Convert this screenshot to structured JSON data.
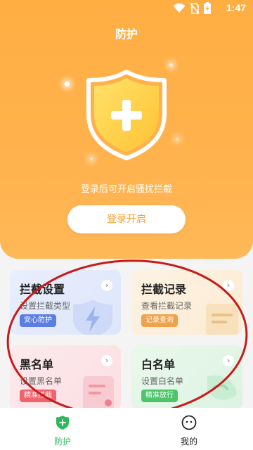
{
  "status": {
    "time": "1:47",
    "icons": [
      "wifi-icon",
      "no-sim-icon",
      "battery-charging-icon"
    ]
  },
  "header": {
    "title": "防护"
  },
  "hero": {
    "hint": "登录后可开启骚扰拦截",
    "login_label": "登录开启",
    "shield_icon": "shield-plus-icon"
  },
  "cards": {
    "intercept_settings": {
      "title": "拦截设置",
      "subtitle": "设置拦截类型",
      "tag": "安心防护",
      "tag_color": "#5b7ee5"
    },
    "intercept_records": {
      "title": "拦截记录",
      "subtitle": "查看拦截记录",
      "tag": "记录查询",
      "tag_color": "#f0a24a"
    },
    "blacklist": {
      "title": "黑名单",
      "subtitle": "设置黑名单",
      "tag": "精准拦截",
      "tag_color": "#f0646e"
    },
    "whitelist": {
      "title": "白名单",
      "subtitle": "设置白名单",
      "tag": "精准放行",
      "tag_color": "#4fc46b"
    }
  },
  "nav": {
    "items": [
      {
        "label": "防护",
        "icon": "shield-plus-icon",
        "active": true,
        "color": "#2eb85c"
      },
      {
        "label": "我的",
        "icon": "smiley-icon",
        "active": false,
        "color": "#222222"
      }
    ]
  },
  "colors": {
    "accent": "#ffae42",
    "annotation": "#c81a1a"
  }
}
